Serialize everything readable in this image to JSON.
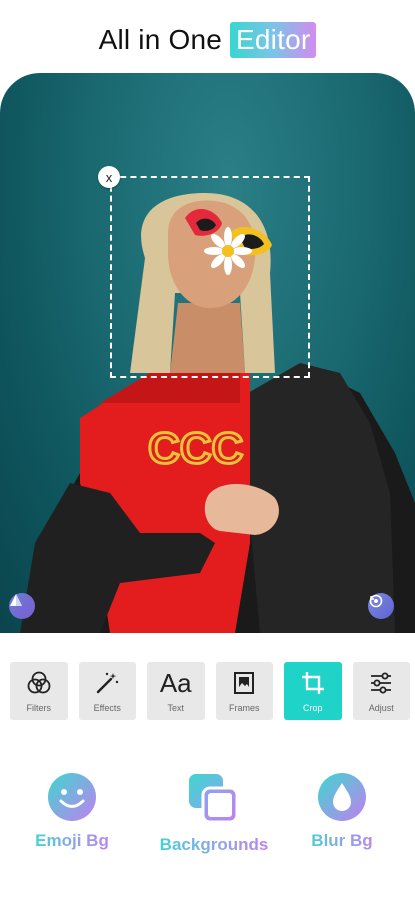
{
  "header": {
    "title_plain": "All in One",
    "title_highlight": "Editor"
  },
  "crop": {
    "close_label": "x"
  },
  "tools": [
    {
      "label": "Filters",
      "icon": "filters-icon"
    },
    {
      "label": "Effects",
      "icon": "magic-wand-icon"
    },
    {
      "label": "Text",
      "icon_text": "Aa"
    },
    {
      "label": "Frames",
      "icon": "frame-icon"
    },
    {
      "label": "Crop",
      "icon": "crop-icon",
      "active": true
    },
    {
      "label": "Adjust",
      "icon": "sliders-icon"
    }
  ],
  "features": [
    {
      "label": "Emoji Bg",
      "icon": "smiley-icon"
    },
    {
      "label": "Backgrounds",
      "icon": "layers-icon"
    },
    {
      "label": "Blur Bg",
      "icon": "drop-icon"
    }
  ],
  "colors": {
    "accent": "#1fd3c8",
    "tile": "#e8e8e8",
    "gradient_start": "#3dd7cf",
    "gradient_end": "#c27ff0"
  }
}
